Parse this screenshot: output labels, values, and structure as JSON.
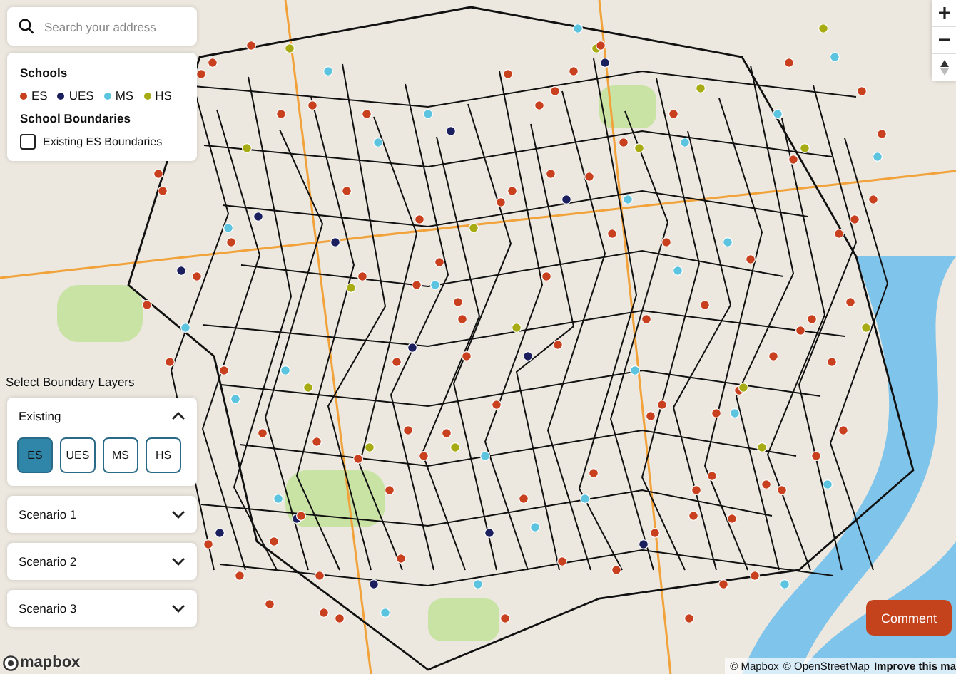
{
  "search": {
    "placeholder": "Search your address"
  },
  "legend": {
    "title": "Schools",
    "items": [
      {
        "label": "ES",
        "color": "#c8401e"
      },
      {
        "label": "UES",
        "color": "#1b1f5e"
      },
      {
        "label": "MS",
        "color": "#5cc4de"
      },
      {
        "label": "HS",
        "color": "#a8ac14"
      }
    ],
    "boundaries_title": "School Boundaries",
    "toggle": {
      "label": "Existing ES Boundaries",
      "checked": false
    }
  },
  "layers": {
    "title": "Select Boundary Layers",
    "sections": [
      {
        "label": "Existing",
        "expanded": true,
        "buttons": [
          {
            "label": "ES",
            "selected": true
          },
          {
            "label": "UES",
            "selected": false
          },
          {
            "label": "MS",
            "selected": false
          },
          {
            "label": "HS",
            "selected": false
          }
        ]
      },
      {
        "label": "Scenario 1",
        "expanded": false
      },
      {
        "label": "Scenario 2",
        "expanded": false
      },
      {
        "label": "Scenario 3",
        "expanded": false
      }
    ]
  },
  "comment_button": "Comment",
  "logo": "mapbox",
  "attribution": [
    "© Mapbox",
    "© OpenStreetMap",
    "Improve this ma"
  ]
}
